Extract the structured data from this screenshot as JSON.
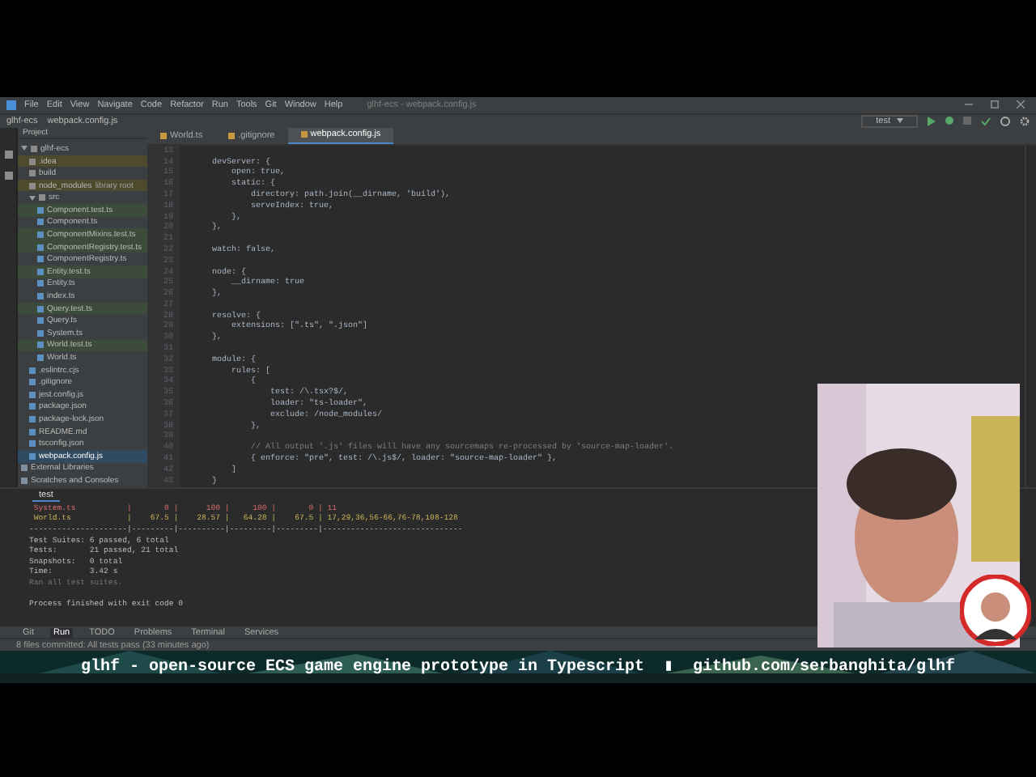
{
  "window": {
    "title": "glhf-ecs - webpack.config.js"
  },
  "menu": [
    "File",
    "Edit",
    "View",
    "Navigate",
    "Code",
    "Refactor",
    "Run",
    "Tools",
    "Git",
    "Window",
    "Help"
  ],
  "breadcrumbs": [
    "glhf-ecs",
    "webpack.config.js"
  ],
  "run_config": "test",
  "project_panel": {
    "title": "Project"
  },
  "editor_tabs": [
    {
      "label": "World.ts",
      "selected": false
    },
    {
      "label": ".gitignore",
      "selected": false
    },
    {
      "label": "webpack.config.js",
      "selected": true
    }
  ],
  "tree": [
    {
      "label": "glhf-ecs",
      "expanded": true,
      "selected": false,
      "children": [
        {
          "label": ".idea",
          "kind": "folder",
          "selected": false,
          "color": "#4d4a2e"
        },
        {
          "label": "build",
          "kind": "folder",
          "selected": false
        },
        {
          "label": "node_modules",
          "note": "library root",
          "kind": "folder",
          "selected": false,
          "color": "#4d4a2e"
        },
        {
          "label": "src",
          "kind": "folder",
          "expanded": true,
          "selected": false,
          "children": [
            {
              "label": "Component.test.ts",
              "kind": "file",
              "selected": false,
              "color": "#3d4b3a"
            },
            {
              "label": "Component.ts",
              "kind": "file",
              "selected": false
            },
            {
              "label": "ComponentMixins.test.ts",
              "kind": "file",
              "selected": false,
              "color": "#3d4b3a"
            },
            {
              "label": "ComponentRegistry.test.ts",
              "kind": "file",
              "selected": false,
              "color": "#3d4b3a"
            },
            {
              "label": "ComponentRegistry.ts",
              "kind": "file",
              "selected": false
            },
            {
              "label": "Entity.test.ts",
              "kind": "file",
              "selected": false,
              "color": "#3d4b3a"
            },
            {
              "label": "Entity.ts",
              "kind": "file",
              "selected": false
            },
            {
              "label": "index.ts",
              "kind": "file",
              "selected": false
            },
            {
              "label": "Query.test.ts",
              "kind": "file",
              "selected": false,
              "color": "#3d4b3a"
            },
            {
              "label": "Query.ts",
              "kind": "file",
              "selected": false
            },
            {
              "label": "System.ts",
              "kind": "file",
              "selected": false
            },
            {
              "label": "World.test.ts",
              "kind": "file",
              "selected": false,
              "color": "#3d4b3a"
            },
            {
              "label": "World.ts",
              "kind": "file",
              "selected": false
            }
          ]
        },
        {
          "label": ".eslintrc.cjs",
          "kind": "file",
          "selected": false
        },
        {
          "label": ".gitignore",
          "kind": "file",
          "selected": false
        },
        {
          "label": "jest.config.js",
          "kind": "file",
          "selected": false
        },
        {
          "label": "package.json",
          "kind": "file",
          "selected": false
        },
        {
          "label": "package-lock.json",
          "kind": "file",
          "selected": false
        },
        {
          "label": "README.md",
          "kind": "file",
          "selected": false
        },
        {
          "label": "tsconfig.json",
          "kind": "file",
          "selected": false
        },
        {
          "label": "webpack.config.js",
          "kind": "file",
          "selected": true
        }
      ]
    },
    {
      "label": "External Libraries",
      "kind": "library",
      "selected": false
    },
    {
      "label": "Scratches and Consoles",
      "kind": "library",
      "selected": false
    }
  ],
  "editor": {
    "lines": [
      {
        "number": "13"
      },
      {
        "number": "14",
        "text": "    devServer: {",
        "kind": "code"
      },
      {
        "number": "15",
        "text": "        open: true,",
        "kind": "code"
      },
      {
        "number": "16",
        "text": "        static: {",
        "kind": "code"
      },
      {
        "number": "17",
        "text": "            directory: path.join(__dirname, 'build'),",
        "kind": "code"
      },
      {
        "number": "18",
        "text": "            serveIndex: true,",
        "kind": "code"
      },
      {
        "number": "19",
        "text": "        },",
        "kind": "code"
      },
      {
        "number": "20",
        "text": "    },",
        "kind": "code"
      },
      {
        "number": "21"
      },
      {
        "number": "22",
        "text": "    watch: false,",
        "kind": "code"
      },
      {
        "number": "23"
      },
      {
        "number": "24",
        "text": "    node: {",
        "kind": "code"
      },
      {
        "number": "25",
        "text": "        __dirname: true",
        "kind": "code"
      },
      {
        "number": "26",
        "text": "    },",
        "kind": "code"
      },
      {
        "number": "27"
      },
      {
        "number": "28",
        "text": "    resolve: {",
        "kind": "code"
      },
      {
        "number": "29",
        "text": "        extensions: [\".ts\", \".json\"]",
        "kind": "code"
      },
      {
        "number": "30",
        "text": "    },",
        "kind": "code"
      },
      {
        "number": "31"
      },
      {
        "number": "32",
        "text": "    module: {",
        "kind": "code"
      },
      {
        "number": "33",
        "text": "        rules: [",
        "kind": "code"
      },
      {
        "number": "34",
        "text": "            {",
        "kind": "code"
      },
      {
        "number": "35",
        "text": "                test: /\\.tsx?$/,",
        "kind": "code"
      },
      {
        "number": "36",
        "text": "                loader: \"ts-loader\",",
        "kind": "code"
      },
      {
        "number": "37",
        "text": "                exclude: /node_modules/",
        "kind": "code"
      },
      {
        "number": "38",
        "text": "            },",
        "kind": "code"
      },
      {
        "number": "39"
      },
      {
        "number": "40",
        "text": "            // All output '.js' files will have any sourcemaps re-processed by 'source-map-loader'.",
        "kind": "comment"
      },
      {
        "number": "41",
        "text": "            { enforce: \"pre\", test: /\\.js$/, loader: \"source-map-loader\" },",
        "kind": "code"
      },
      {
        "number": "42",
        "text": "        ]",
        "kind": "code"
      },
      {
        "number": "43",
        "text": "    }",
        "kind": "code"
      }
    ]
  },
  "run_panel": {
    "tab": "test",
    "output": [
      {
        "text": " System.ts           |       0 |      100 |     100 |       0 | 11",
        "kind": "error"
      },
      {
        "text": " World.ts            |    67.5 |    28.57 |   64.28 |    67.5 | 17,29,36,56-66,76-78,108-128",
        "kind": "warning"
      },
      {
        "text": "---------------------|---------|----------|---------|---------|------------------------------",
        "kind": "plain"
      },
      {
        "text": "Test Suites: 6 passed, 6 total",
        "kind": "plain"
      },
      {
        "text": "Tests:       21 passed, 21 total",
        "kind": "plain"
      },
      {
        "text": "Snapshots:   0 total",
        "kind": "plain"
      },
      {
        "text": "Time:        3.42 s",
        "kind": "plain"
      },
      {
        "text": "Ran all test suites.",
        "kind": "muted"
      },
      {
        "text": "Process finished with exit code 0",
        "kind": "plain"
      }
    ]
  },
  "tool_tabs": [
    {
      "label": "Git",
      "selected": false
    },
    {
      "label": "Run",
      "selected": true
    },
    {
      "label": "TODO",
      "selected": false
    },
    {
      "label": "Problems",
      "selected": false
    },
    {
      "label": "Terminal",
      "selected": false
    },
    {
      "label": "Services",
      "selected": false
    }
  ],
  "status_bar": "8 files committed: All tests pass (33 minutes ago)",
  "banner": {
    "texts": [
      "glhf - open-source ECS game engine prototype in Typescript",
      "▮",
      "github.com/serbanghita/glhf"
    ]
  }
}
